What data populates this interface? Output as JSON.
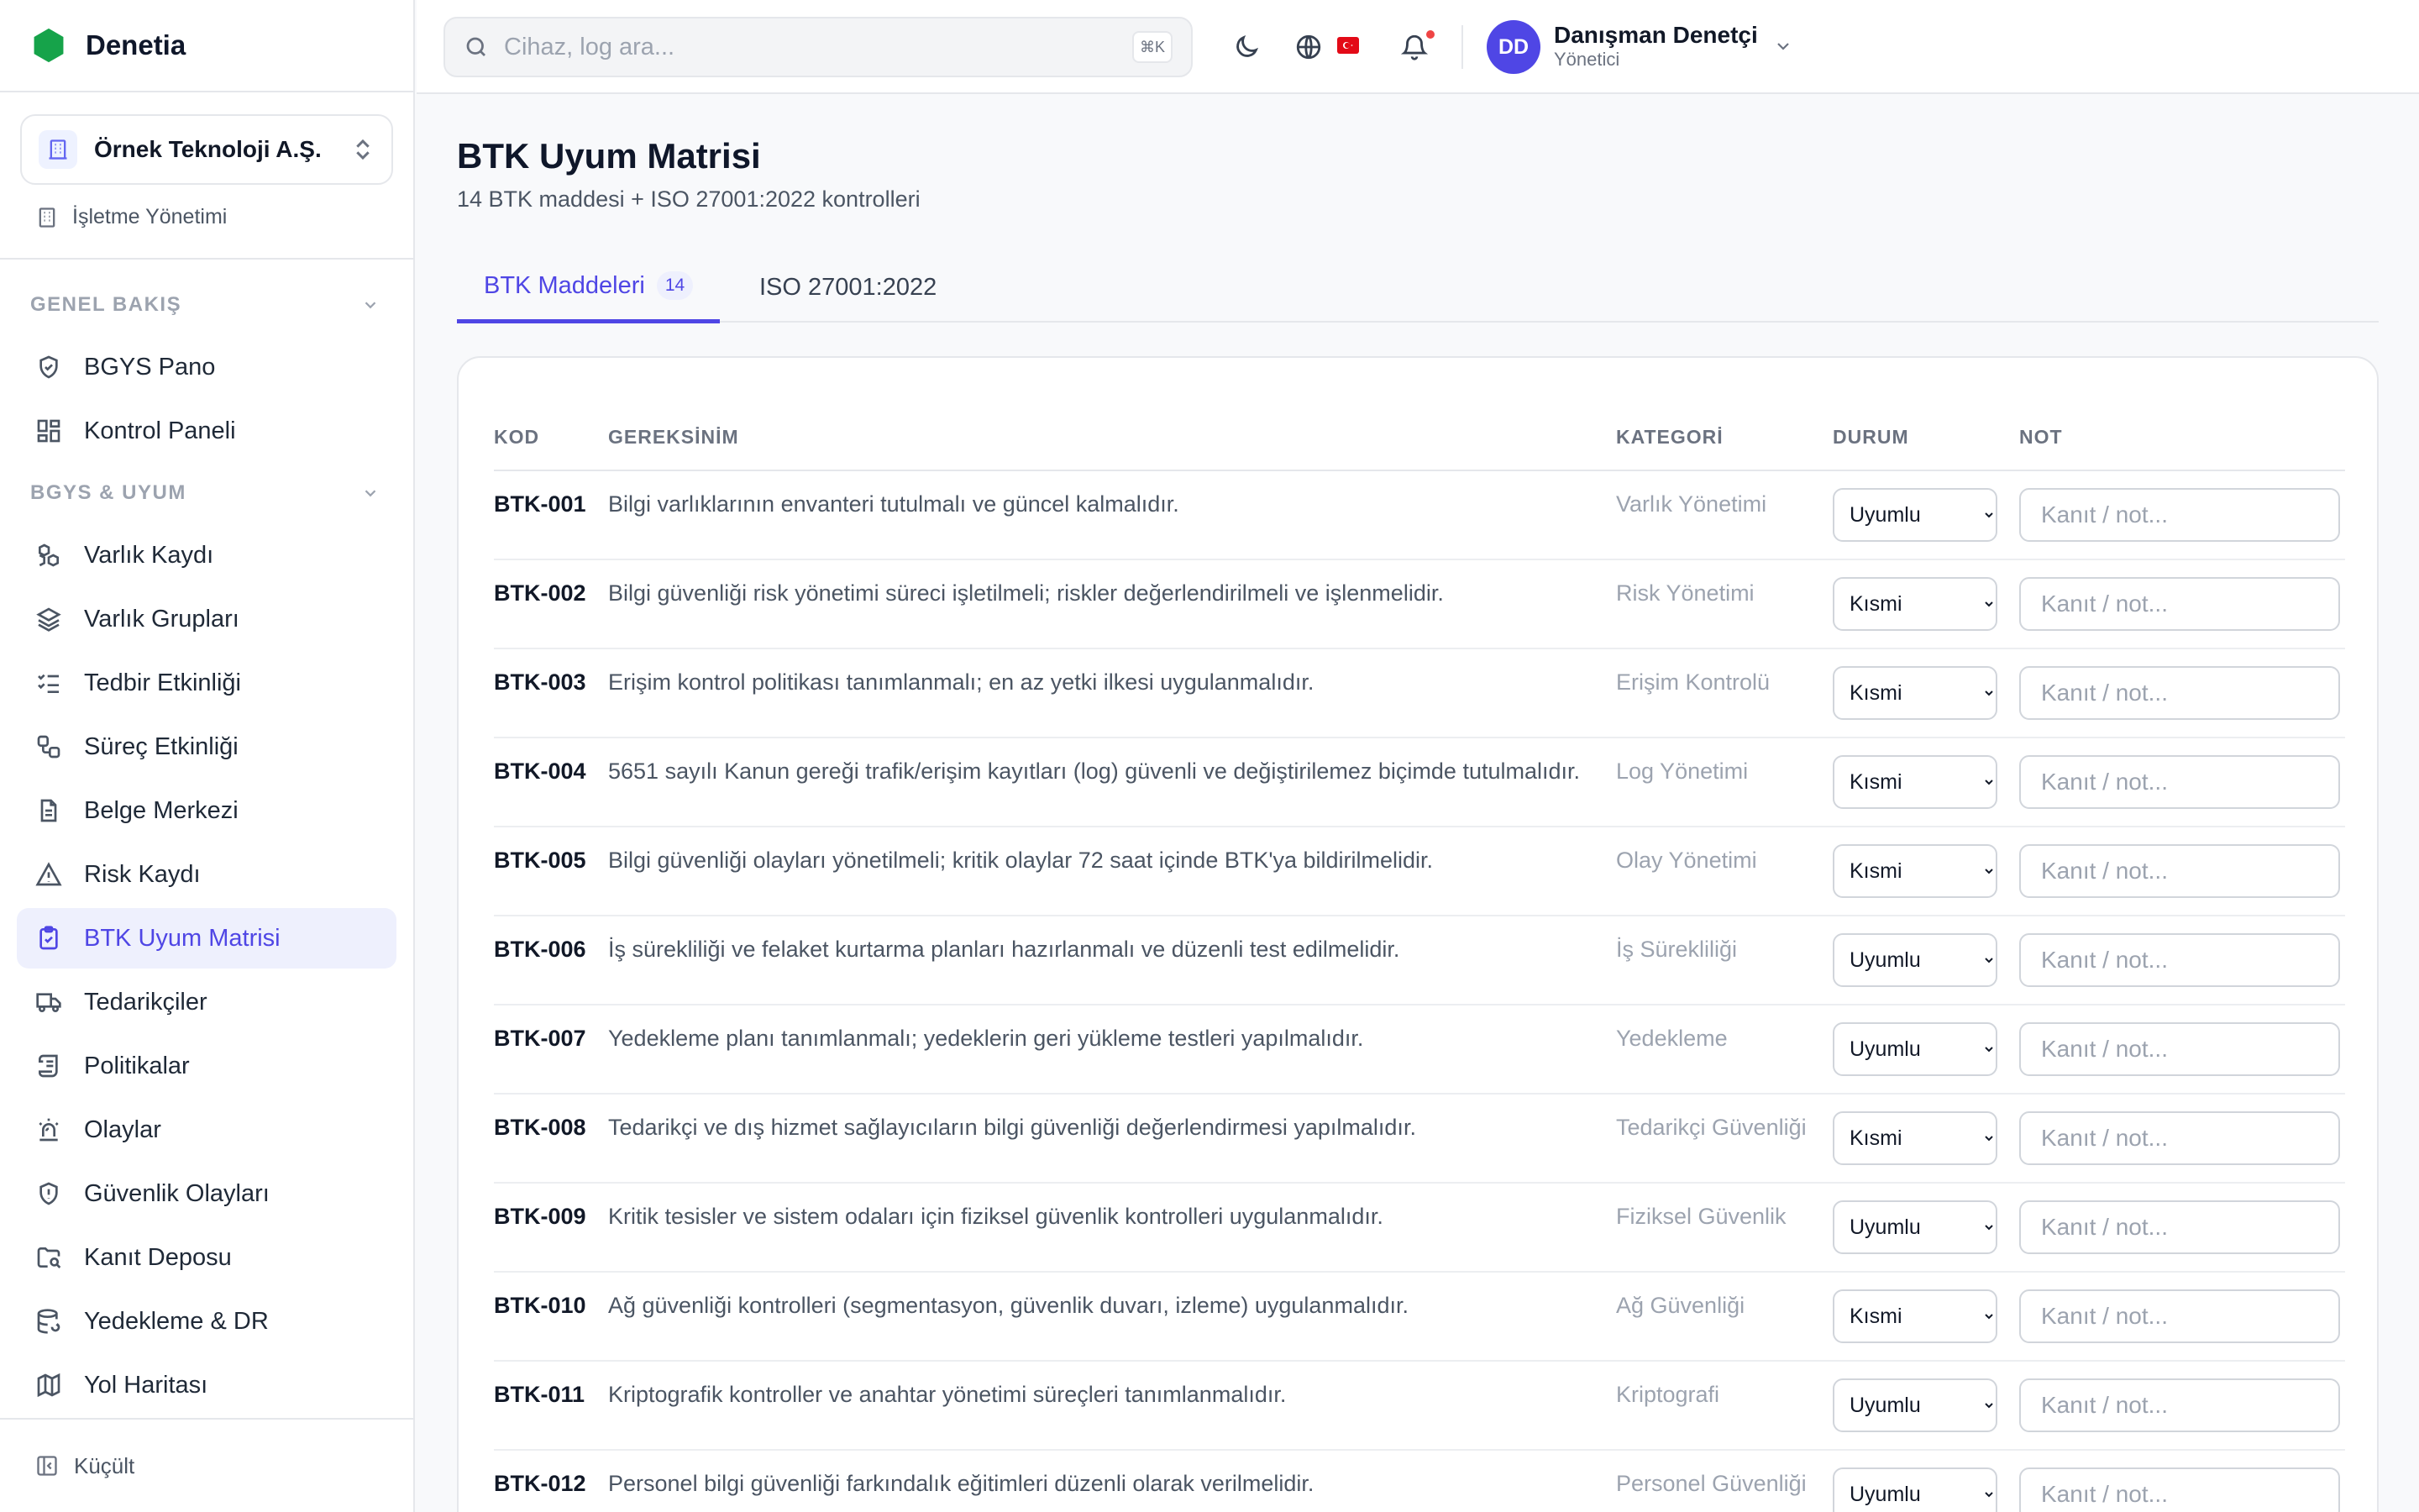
{
  "app": {
    "name": "Denetia",
    "brand_color": "#16a34a",
    "accent": "#4f46e5"
  },
  "sidebar": {
    "org": "Örnek Teknoloji A.Ş.",
    "business_link": "İşletme Yönetimi",
    "sections": [
      {
        "title": "GENEL BAKIŞ",
        "items": [
          {
            "label": "BGYS Pano",
            "icon": "shield-check-icon"
          },
          {
            "label": "Kontrol Paneli",
            "icon": "dashboard-grid-icon"
          }
        ]
      },
      {
        "title": "BGYS & UYUM",
        "items": [
          {
            "label": "Varlık Kaydı",
            "icon": "boxes-icon"
          },
          {
            "label": "Varlık Grupları",
            "icon": "layers-icon"
          },
          {
            "label": "Tedbir Etkinliği",
            "icon": "checklist-icon"
          },
          {
            "label": "Süreç Etkinliği",
            "icon": "workflow-icon"
          },
          {
            "label": "Belge Merkezi",
            "icon": "document-icon"
          },
          {
            "label": "Risk Kaydı",
            "icon": "warning-triangle-icon"
          },
          {
            "label": "BTK Uyum Matrisi",
            "icon": "clipboard-check-icon",
            "active": true
          },
          {
            "label": "Tedarikçiler",
            "icon": "truck-icon"
          },
          {
            "label": "Politikalar",
            "icon": "scroll-icon"
          },
          {
            "label": "Olaylar",
            "icon": "siren-icon"
          },
          {
            "label": "Güvenlik Olayları",
            "icon": "shield-alert-icon"
          },
          {
            "label": "Kanıt Deposu",
            "icon": "folder-search-icon"
          },
          {
            "label": "Yedekleme & DR",
            "icon": "database-backup-icon"
          },
          {
            "label": "Yol Haritası",
            "icon": "map-icon"
          }
        ]
      }
    ],
    "collapse_label": "Küçült"
  },
  "header": {
    "search_placeholder": "Cihaz, log ara...",
    "search_shortcut": "⌘K",
    "user_initials": "DD",
    "user_name": "Danışman Denetçi",
    "user_role": "Yönetici"
  },
  "page": {
    "title": "BTK Uyum Matrisi",
    "subtitle": "14 BTK maddesi + ISO 27001:2022 kontrolleri",
    "tabs": [
      {
        "label": "BTK Maddeleri",
        "badge": "14",
        "active": true
      },
      {
        "label": "ISO 27001:2022"
      }
    ]
  },
  "table": {
    "headers": {
      "code": "KOD",
      "requirement": "GEREKSİNİM",
      "category": "KATEGORİ",
      "status": "DURUM",
      "note": "NOT"
    },
    "status_options": [
      "Uyumlu",
      "Kısmi"
    ],
    "note_placeholder": "Kanıt / not...",
    "rows": [
      {
        "code": "BTK-001",
        "requirement": "Bilgi varlıklarının envanteri tutulmalı ve güncel kalmalıdır.",
        "category": "Varlık Yönetimi",
        "status": "Uyumlu"
      },
      {
        "code": "BTK-002",
        "requirement": "Bilgi güvenliği risk yönetimi süreci işletilmeli; riskler değerlendirilmeli ve işlenmelidir.",
        "category": "Risk Yönetimi",
        "status": "Kısmi"
      },
      {
        "code": "BTK-003",
        "requirement": "Erişim kontrol politikası tanımlanmalı; en az yetki ilkesi uygulanmalıdır.",
        "category": "Erişim Kontrolü",
        "status": "Kısmi"
      },
      {
        "code": "BTK-004",
        "requirement": "5651 sayılı Kanun gereği trafik/erişim kayıtları (log) güvenli ve değiştirilemez biçimde tutulmalıdır.",
        "category": "Log Yönetimi",
        "status": "Kısmi"
      },
      {
        "code": "BTK-005",
        "requirement": "Bilgi güvenliği olayları yönetilmeli; kritik olaylar 72 saat içinde BTK'ya bildirilmelidir.",
        "category": "Olay Yönetimi",
        "status": "Kısmi"
      },
      {
        "code": "BTK-006",
        "requirement": "İş sürekliliği ve felaket kurtarma planları hazırlanmalı ve düzenli test edilmelidir.",
        "category": "İş Sürekliliği",
        "status": "Uyumlu"
      },
      {
        "code": "BTK-007",
        "requirement": "Yedekleme planı tanımlanmalı; yedeklerin geri yükleme testleri yapılmalıdır.",
        "category": "Yedekleme",
        "status": "Uyumlu"
      },
      {
        "code": "BTK-008",
        "requirement": "Tedarikçi ve dış hizmet sağlayıcıların bilgi güvenliği değerlendirmesi yapılmalıdır.",
        "category": "Tedarikçi Güvenliği",
        "status": "Kısmi"
      },
      {
        "code": "BTK-009",
        "requirement": "Kritik tesisler ve sistem odaları için fiziksel güvenlik kontrolleri uygulanmalıdır.",
        "category": "Fiziksel Güvenlik",
        "status": "Uyumlu"
      },
      {
        "code": "BTK-010",
        "requirement": "Ağ güvenliği kontrolleri (segmentasyon, güvenlik duvarı, izleme) uygulanmalıdır.",
        "category": "Ağ Güvenliği",
        "status": "Kısmi"
      },
      {
        "code": "BTK-011",
        "requirement": "Kriptografik kontroller ve anahtar yönetimi süreçleri tanımlanmalıdır.",
        "category": "Kriptografi",
        "status": "Uyumlu"
      },
      {
        "code": "BTK-012",
        "requirement": "Personel bilgi güvenliği farkındalık eğitimleri düzenli olarak verilmelidir.",
        "category": "Personel Güvenliği",
        "status": "Uyumlu"
      }
    ]
  }
}
